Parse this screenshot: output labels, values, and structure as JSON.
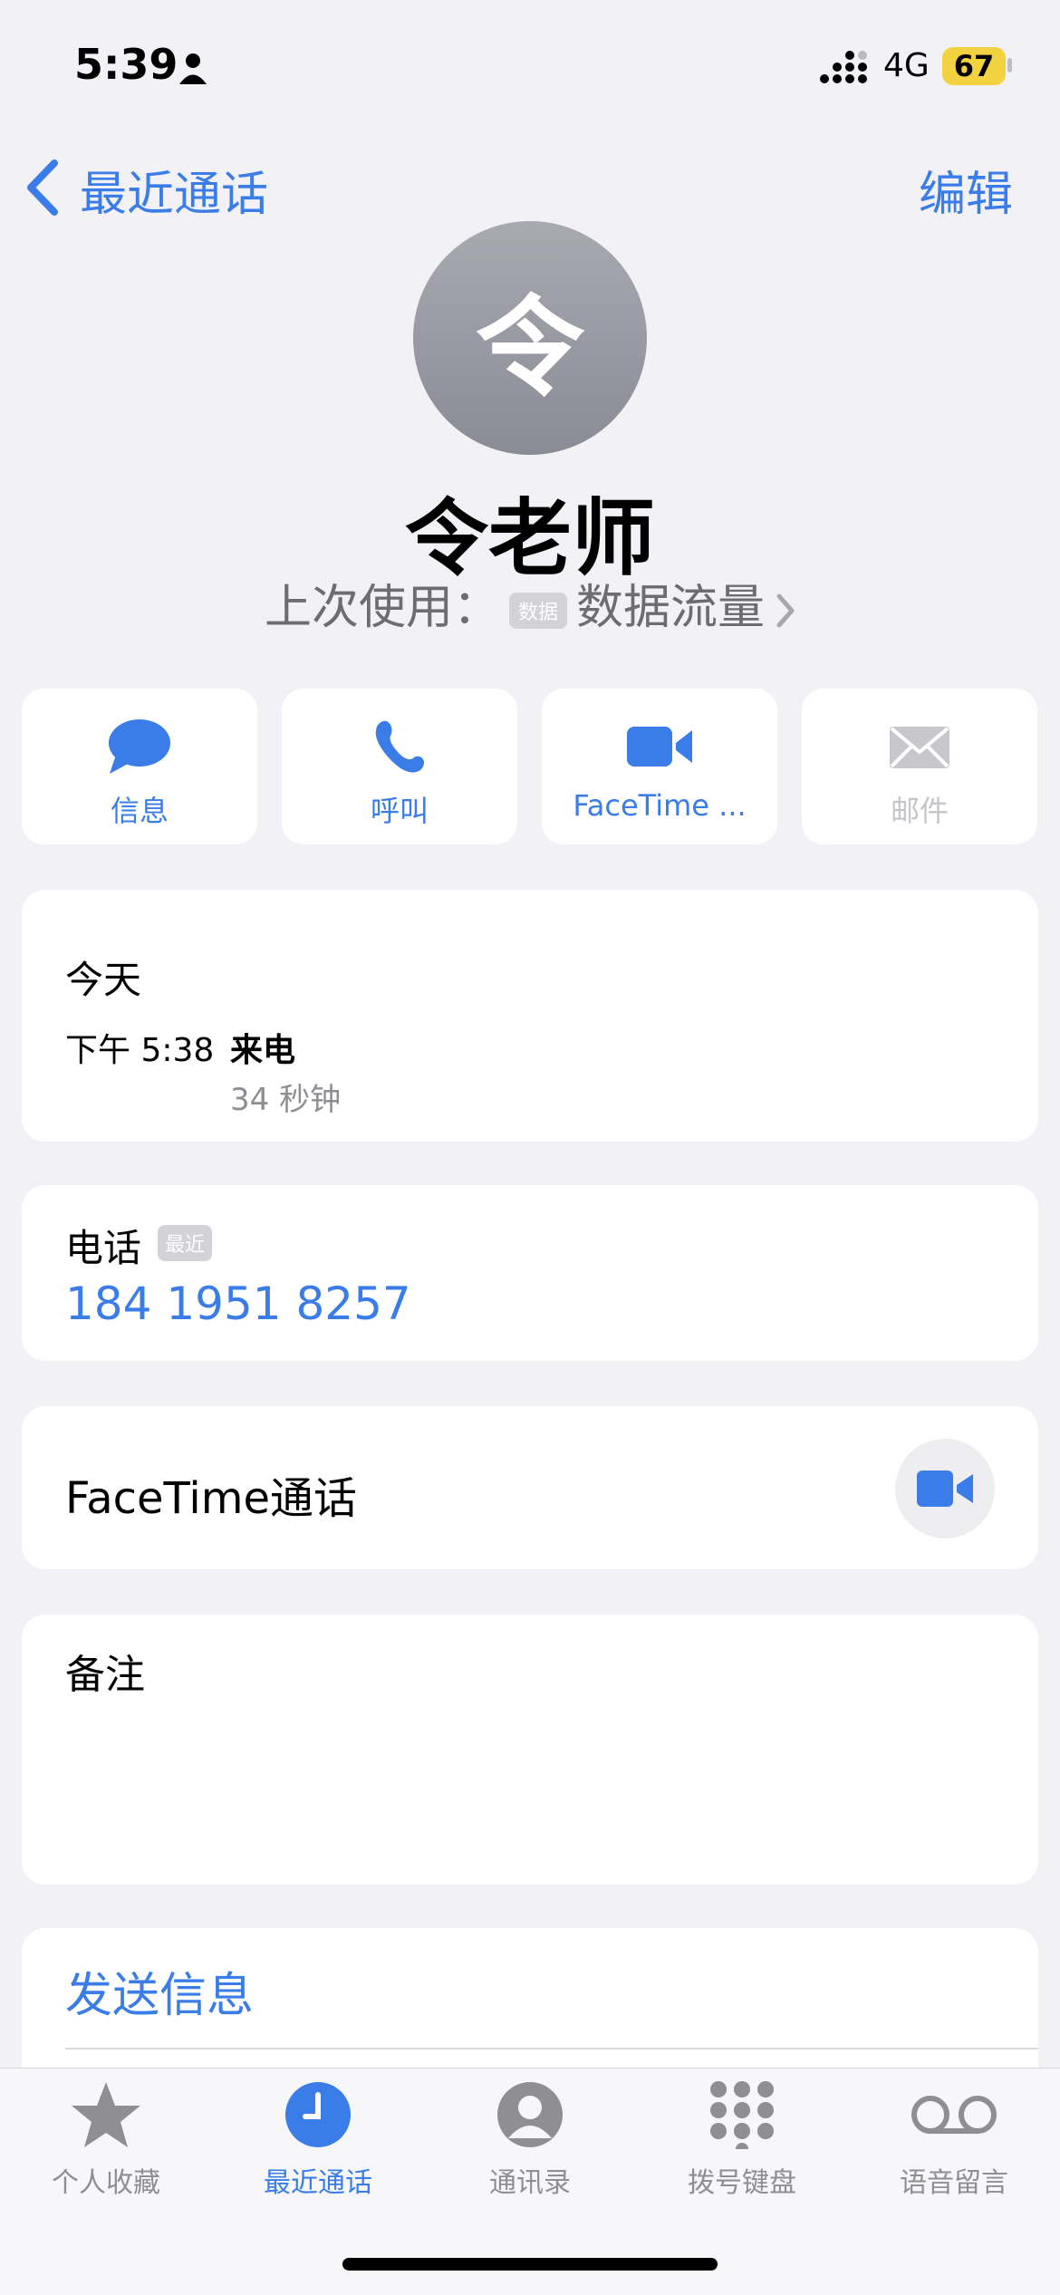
{
  "status": {
    "time": "5:39",
    "network": "4G",
    "battery": "67"
  },
  "nav": {
    "back_label": "最近通话",
    "edit_label": "编辑"
  },
  "contact": {
    "avatar_char": "令",
    "name": "令老师",
    "last_used_prefix": "上次使用：",
    "last_used_tag": "数据",
    "last_used_value": "数据流量"
  },
  "actions": [
    {
      "label": "信息",
      "icon": "message-bubble-icon"
    },
    {
      "label": "呼叫",
      "icon": "phone-icon"
    },
    {
      "label": "FaceTime ...",
      "icon": "video-camera-icon"
    },
    {
      "label": "邮件",
      "icon": "mail-icon",
      "disabled": true
    }
  ],
  "history": {
    "title": "今天",
    "time": "下午 5:38",
    "type": "来电",
    "duration": "34 秒钟"
  },
  "phone": {
    "label": "电话",
    "badge": "最近",
    "number": "184 1951 8257"
  },
  "facetime": {
    "label": "FaceTime通话"
  },
  "notes": {
    "label": "备注"
  },
  "send_message": {
    "label": "发送信息"
  },
  "tabs": [
    {
      "label": "个人收藏",
      "icon": "star-icon"
    },
    {
      "label": "最近通话",
      "icon": "clock-icon",
      "active": true
    },
    {
      "label": "通讯录",
      "icon": "person-circle-icon"
    },
    {
      "label": "拨号键盘",
      "icon": "keypad-icon"
    },
    {
      "label": "语音留言",
      "icon": "voicemail-icon"
    }
  ],
  "colors": {
    "accent": "#3a7ce8",
    "background": "#f1f1f6",
    "battery": "#f2d240"
  }
}
